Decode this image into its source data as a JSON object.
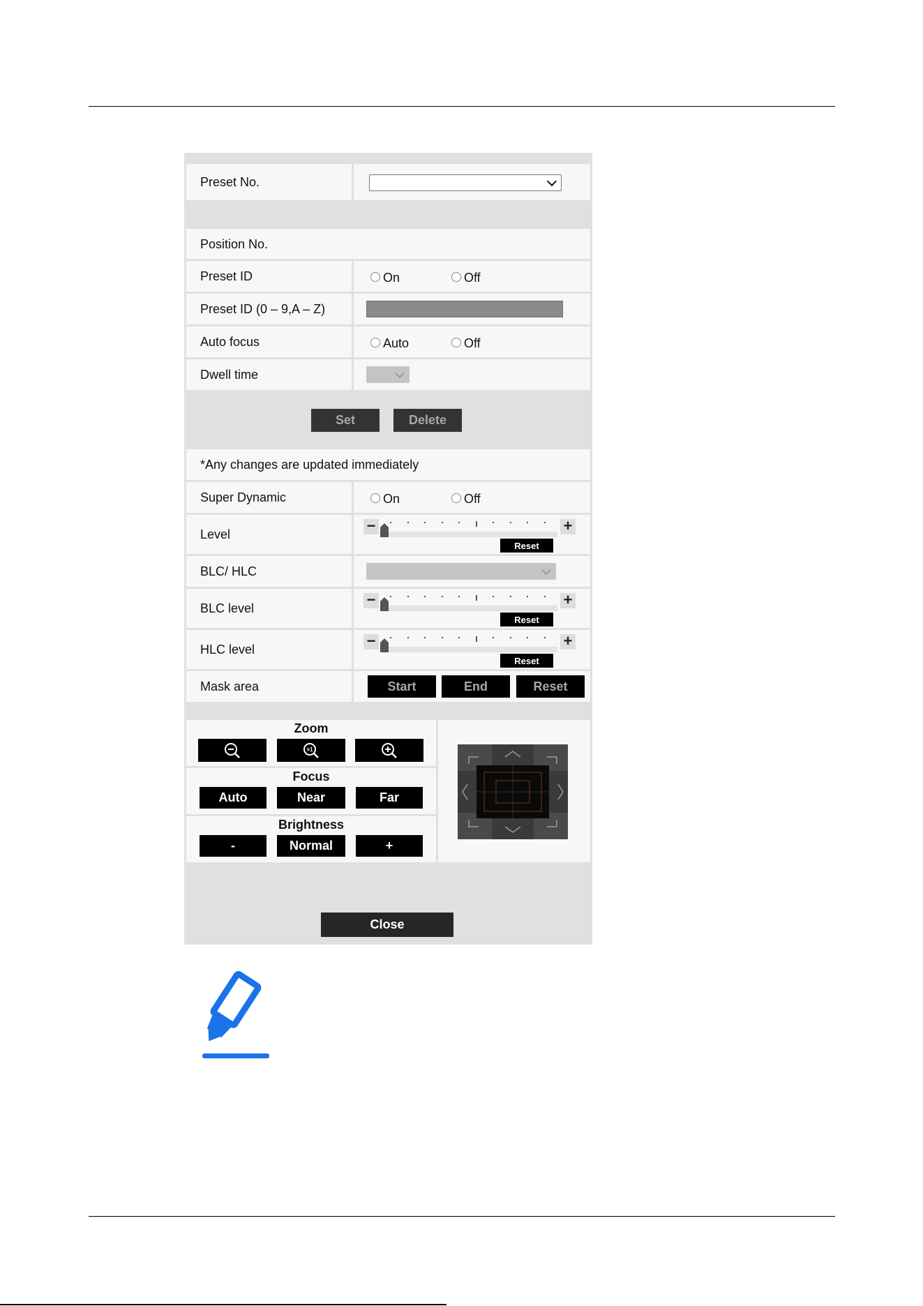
{
  "preset": {
    "no_label": "Preset No.",
    "no_value": ""
  },
  "position": {
    "no_label": "Position No.",
    "preset_id_label": "Preset ID",
    "preset_id_options": [
      "On",
      "Off"
    ],
    "preset_id_text_label": "Preset ID (0 – 9,A – Z)",
    "auto_focus_label": "Auto focus",
    "auto_focus_options": [
      "Auto",
      "Off"
    ],
    "dwell_time_label": "Dwell time",
    "set_button": "Set",
    "delete_button": "Delete"
  },
  "image": {
    "notice": "*Any changes are updated immediately",
    "super_dynamic_label": "Super Dynamic",
    "super_dynamic_options": [
      "On",
      "Off"
    ],
    "level_label": "Level",
    "blc_hlc_label": "BLC/ HLC",
    "blc_level_label": "BLC level",
    "hlc_level_label": "HLC level",
    "reset_button": "Reset",
    "mask_area_label": "Mask area",
    "mask_buttons": [
      "Start",
      "End",
      "Reset"
    ],
    "level_value": 0,
    "blc_level_value": 0,
    "hlc_level_value": 0
  },
  "controls": {
    "zoom_label": "Zoom",
    "zoom_mid_glyph": "×1",
    "focus_label": "Focus",
    "focus_buttons": [
      "Auto",
      "Near",
      "Far"
    ],
    "brightness_label": "Brightness",
    "brightness_buttons": [
      "-",
      "Normal",
      "+"
    ]
  },
  "close_button": "Close",
  "colors": {
    "panel_bg": "#e0e0e0",
    "cell_bg": "#f7f7f7",
    "button_bg": "#000000",
    "note_icon": "#1a73e8"
  },
  "icons": [
    "zoom-out-icon",
    "zoom-reset-icon",
    "zoom-in-icon",
    "pan-tilt-pad-icon",
    "note-pen-icon"
  ]
}
